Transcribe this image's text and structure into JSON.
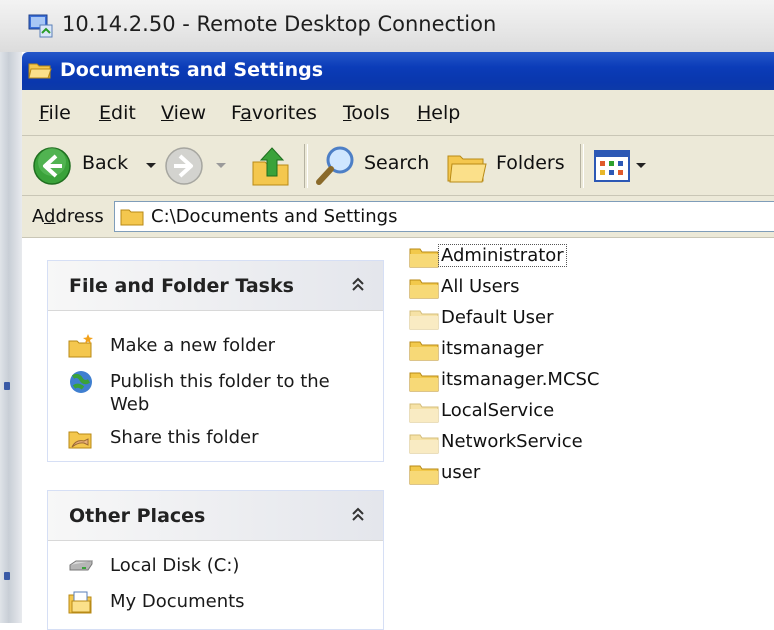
{
  "rdp_window": {
    "title": "10.14.2.50 - Remote Desktop Connection",
    "icon": "remote-desktop-icon"
  },
  "explorer": {
    "title": "Documents and Settings",
    "menu": [
      {
        "label": "File",
        "underline": "F",
        "rest": "ile"
      },
      {
        "label": "Edit",
        "underline": "E",
        "rest": "dit"
      },
      {
        "label": "View",
        "underline": "V",
        "rest": "iew"
      },
      {
        "label": "Favorites",
        "pre": "F",
        "underline": "a",
        "rest": "vorites"
      },
      {
        "label": "Tools",
        "underline": "T",
        "rest": "ools"
      },
      {
        "label": "Help",
        "underline": "H",
        "rest": "elp"
      }
    ],
    "toolbar": {
      "back_label": "Back",
      "search_label": "Search",
      "folders_label": "Folders"
    },
    "address": {
      "label": "Address",
      "label_pre": "A",
      "label_underline": "d",
      "label_rest": "dress",
      "value": "C:\\Documents and Settings"
    },
    "task_pane": {
      "file_folder_tasks": {
        "title": "File and Folder Tasks",
        "items": [
          {
            "label": "Make a new folder",
            "icon": "new-folder-icon"
          },
          {
            "label": "Publish this folder to the Web",
            "icon": "publish-web-icon"
          },
          {
            "label": "Share this folder",
            "icon": "share-folder-icon"
          }
        ]
      },
      "other_places": {
        "title": "Other Places",
        "items": [
          {
            "label": "Local Disk (C:)",
            "icon": "local-disk-icon"
          },
          {
            "label": "My Documents",
            "icon": "my-documents-icon"
          }
        ]
      }
    },
    "files": [
      {
        "name": "Administrator",
        "selected": true,
        "pale": false
      },
      {
        "name": "All Users",
        "selected": false,
        "pale": false
      },
      {
        "name": "Default User",
        "selected": false,
        "pale": true
      },
      {
        "name": "itsmanager",
        "selected": false,
        "pale": false
      },
      {
        "name": "itsmanager.MCSC",
        "selected": false,
        "pale": false
      },
      {
        "name": "LocalService",
        "selected": false,
        "pale": true
      },
      {
        "name": "NetworkService",
        "selected": false,
        "pale": true
      },
      {
        "name": "user",
        "selected": false,
        "pale": false
      }
    ],
    "colors": {
      "xp_title_blue": "#0a37ad",
      "chrome_beige": "#ece9d8",
      "back_green": "#3aa23a",
      "folder_yellow": "#f2c94c",
      "folder_pale": "#f6e2a6"
    }
  }
}
